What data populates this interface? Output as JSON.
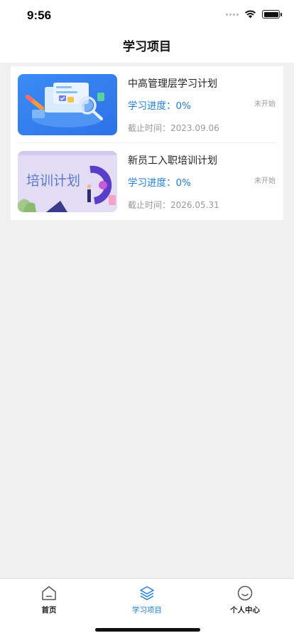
{
  "status_bar": {
    "time": "9:56"
  },
  "nav": {
    "title": "学习项目"
  },
  "items": [
    {
      "title": "中高管理层学习计划",
      "progress": "学习进度：0%",
      "status": "未开始",
      "deadline": "截止时间：2023.09.06",
      "thumbnail_icon": "study-illustration-icon"
    },
    {
      "title": "新员工入职培训计划",
      "progress": "学习进度：0%",
      "status": "未开始",
      "deadline": "截止时间：2026.05.31",
      "thumbnail_icon": "training-plan-illustration-icon",
      "thumbnail_text": "培训计划"
    }
  ],
  "tabs": [
    {
      "label": "首页",
      "icon": "home-icon",
      "active": false
    },
    {
      "label": "学习项目",
      "icon": "layers-icon",
      "active": true
    },
    {
      "label": "个人中心",
      "icon": "smile-face-icon",
      "active": false
    }
  ],
  "colors": {
    "accent": "#1f7fd9",
    "muted": "#9a9a9a",
    "background": "#f0f0f0"
  }
}
